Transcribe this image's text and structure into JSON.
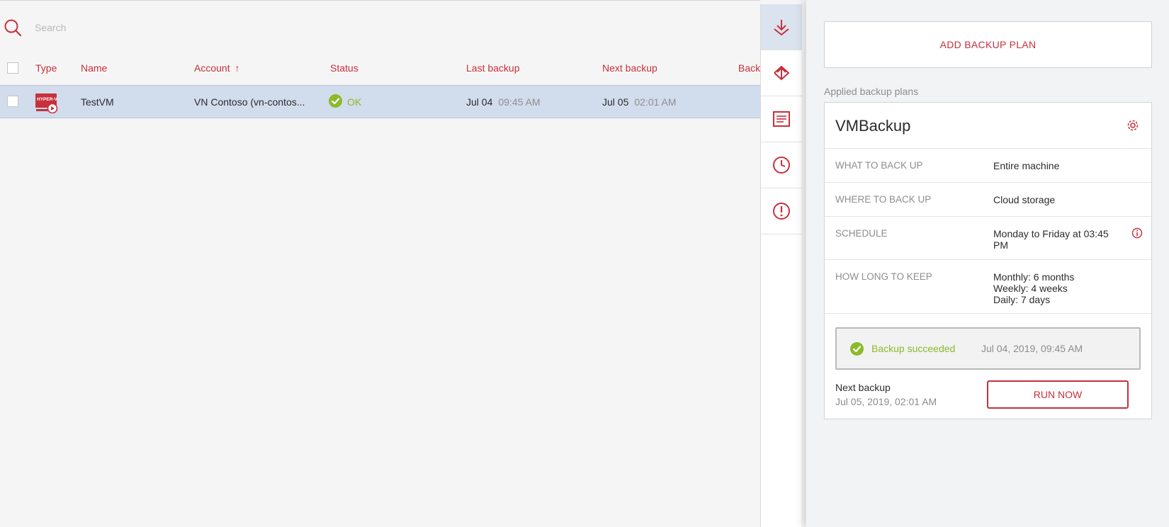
{
  "colors": {
    "accent": "#c7303c",
    "success": "#8cba2a",
    "selected_row": "#d1dcec"
  },
  "search": {
    "placeholder": "Search",
    "icon": "search-icon"
  },
  "table": {
    "columns": [
      "Type",
      "Name",
      "Account",
      "Status",
      "Last backup",
      "Next backup",
      "Back"
    ],
    "sort_indicator": "↑",
    "rows": [
      {
        "type_icon": "hyperv-vm-icon",
        "name": "TestVM",
        "account": "VN Contoso (vn-contos...",
        "status": "OK",
        "last_backup_date": "Jul 04",
        "last_backup_time": "09:45 AM",
        "next_backup_date": "Jul 05",
        "next_backup_time": "02:01 AM"
      }
    ]
  },
  "action_strip": [
    {
      "icon": "backup-download-icon",
      "active": true
    },
    {
      "icon": "recovery-icon",
      "active": false
    },
    {
      "icon": "backups-list-icon",
      "active": false
    },
    {
      "icon": "activities-clock-icon",
      "active": false
    },
    {
      "icon": "alerts-icon",
      "active": false
    }
  ],
  "panel": {
    "add_plan_label": "ADD BACKUP PLAN",
    "applied_label": "Applied backup plans",
    "plan": {
      "title": "VMBackup",
      "what_key": "WHAT TO BACK UP",
      "what_value": "Entire machine",
      "where_key": "WHERE TO BACK UP",
      "where_value": "Cloud storage",
      "schedule_key": "SCHEDULE",
      "schedule_value_line1": "Monday to Friday at 03:45",
      "schedule_value_line2": "PM",
      "keep_key": "HOW LONG TO KEEP",
      "keep_line1": "Monthly: 6 months",
      "keep_line2": "Weekly: 4 weeks",
      "keep_line3": "Daily: 7 days",
      "result_message": "Backup succeeded",
      "result_time": "Jul 04, 2019, 09:45 AM",
      "next_backup_label": "Next backup",
      "next_backup_value": "Jul 05, 2019, 02:01 AM",
      "run_now_label": "RUN NOW"
    }
  }
}
